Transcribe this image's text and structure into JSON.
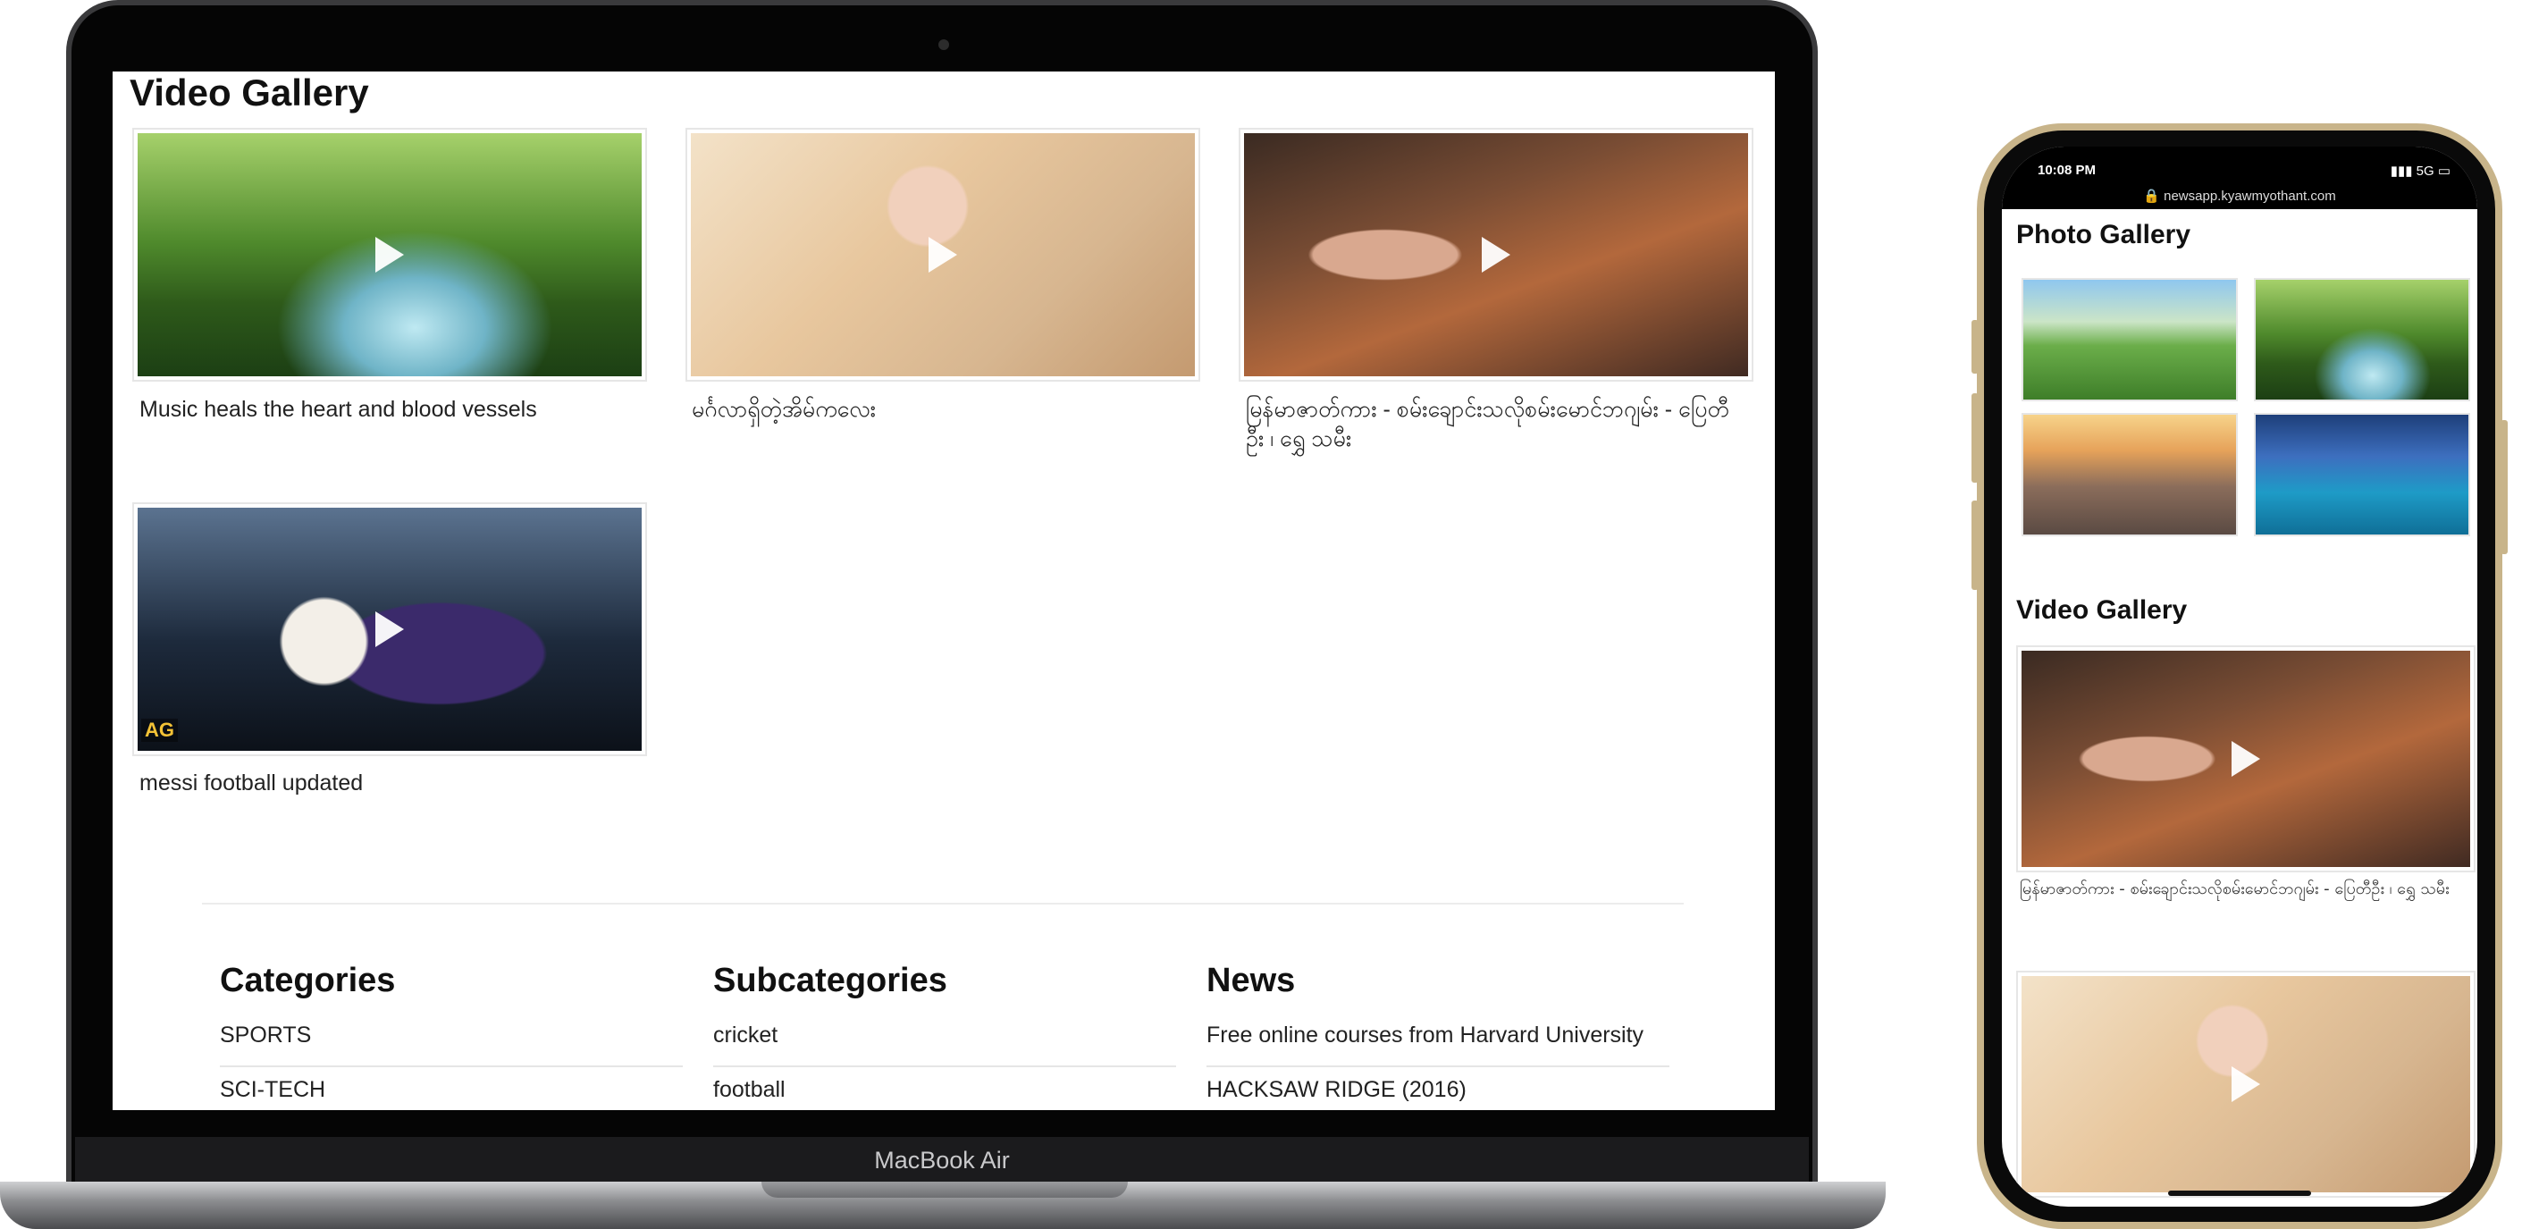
{
  "laptop": {
    "brand_label": "MacBook Air",
    "video_gallery": {
      "title": "Video Gallery",
      "videos": [
        {
          "caption": "Music heals the heart and blood vessels"
        },
        {
          "caption": "မင်္ဂလာရှိတဲ့အိမ်ကလေး"
        },
        {
          "caption": "မြန်မာဇာတ်ကား - စမ်းချောင်းသလိုစမ်းမောင်ဘဂျမ်း - ပြေတီဦး ၊ ရွှေ သမီး"
        },
        {
          "caption": "messi football updated"
        }
      ]
    },
    "footer": {
      "categories": {
        "title": "Categories",
        "items": [
          "SPORTS",
          "SCI-TECH"
        ]
      },
      "subcategories": {
        "title": "Subcategories",
        "items": [
          "cricket",
          "football"
        ]
      },
      "news": {
        "title": "News",
        "items": [
          "Free online courses from Harvard University",
          "HACKSAW RIDGE (2016)"
        ]
      }
    }
  },
  "phone": {
    "status": {
      "time": "10:08 PM",
      "signal": "5G",
      "url": "newsapp.kyawmyothant.com"
    },
    "photo_gallery": {
      "title": "Photo Gallery"
    },
    "video_gallery": {
      "title": "Video Gallery",
      "videos": [
        {
          "caption": "မြန်မာဇာတ်ကား - စမ်းချောင်းသလိုစမ်းမောင်ဘဂျမ်း - ပြေတီဦး ၊ ရွှေ သမီး"
        }
      ]
    }
  },
  "badges": {
    "ag": "AG"
  },
  "colors": {
    "frame_gold": "#c8b48a",
    "laptop_bezel": "#050505"
  }
}
